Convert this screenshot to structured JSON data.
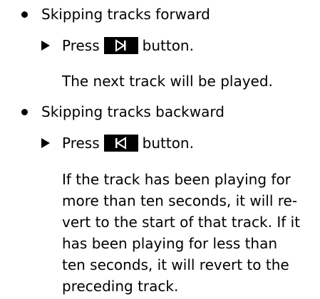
{
  "items": [
    {
      "heading": "Skipping tracks forward",
      "step_prefix": "Press",
      "step_button_icon": "skip-forward-icon",
      "step_suffix": "button.",
      "result_lines": [
        "The next track will be played."
      ]
    },
    {
      "heading": "Skipping tracks backward",
      "step_prefix": "Press",
      "step_button_icon": "skip-backward-icon",
      "step_suffix": "button.",
      "result_lines": [
        "If the track has been playing for",
        "more than ten seconds, it will re-",
        "vert to the start of that track. If it",
        "has been playing for less than",
        "ten seconds, it will revert to the",
        "preceding track."
      ]
    }
  ],
  "colors": {
    "text": "#000000",
    "icon_background": "#000000",
    "icon_glyph": "#ffffff"
  }
}
